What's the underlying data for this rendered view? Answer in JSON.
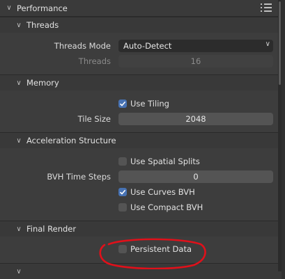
{
  "panel": {
    "title": "Performance"
  },
  "threads": {
    "title": "Threads",
    "mode_label": "Threads Mode",
    "mode_value": "Auto-Detect",
    "threads_label": "Threads",
    "threads_value": "16"
  },
  "memory": {
    "title": "Memory",
    "use_tiling_label": "Use Tiling",
    "use_tiling_checked": true,
    "tile_size_label": "Tile Size",
    "tile_size_value": "2048"
  },
  "acceleration": {
    "title": "Acceleration Structure",
    "spatial_splits_label": "Use Spatial Splits",
    "spatial_splits_checked": false,
    "bvh_label": "BVH Time Steps",
    "bvh_value": "0",
    "curves_bvh_label": "Use Curves BVH",
    "curves_bvh_checked": true,
    "compact_bvh_label": "Use Compact BVH",
    "compact_bvh_checked": false
  },
  "final_render": {
    "title": "Final Render",
    "persistent_label": "Persistent Data",
    "persistent_checked": false
  },
  "colors": {
    "accent": "#4772b3",
    "annotation": "#e0101a"
  },
  "icons": {
    "chevron_down": "chevron-down-icon",
    "drag": "drag-handle-icon",
    "check": "checkmark-icon"
  }
}
